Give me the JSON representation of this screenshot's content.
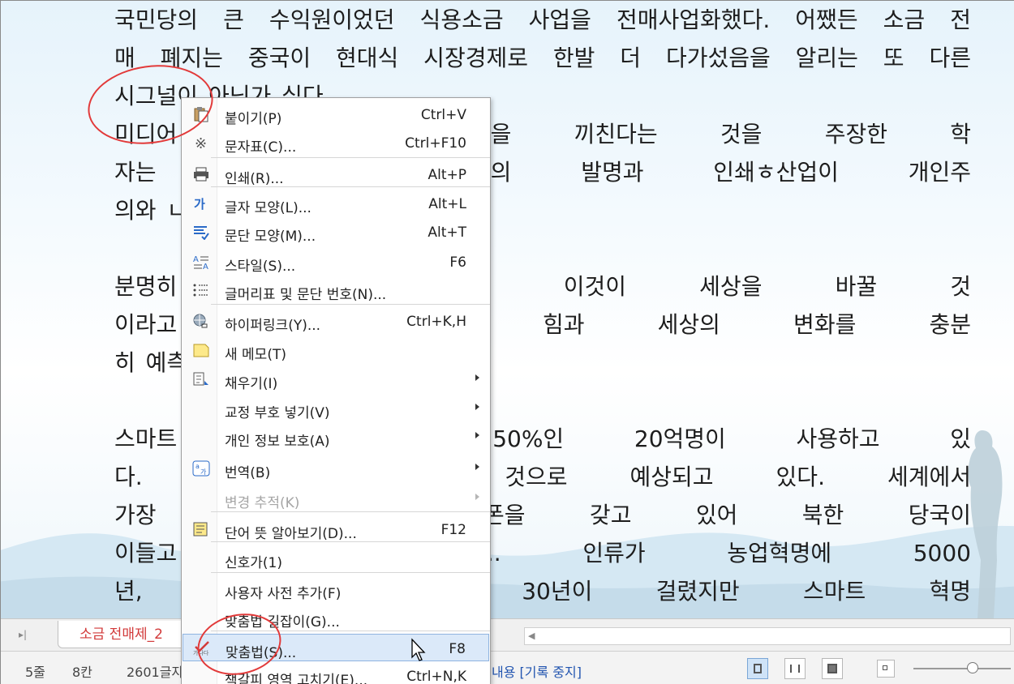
{
  "document": {
    "lines": [
      {
        "text": "국민당의 큰 수익원이었던 식용소금 사업을 전매사업화했다. 어쨌든 소금 전",
        "last": false
      },
      {
        "text": "매 폐지는 중국이 현대식 시장경제로 한발 더 다가섰음을 알리는 또 다른",
        "last": false
      },
      {
        "text": "시그널이 아닌가 싶다.",
        "last": true
      },
      {
        "text": "미디어                        에 엄청난 영향을 끼친다는 것을 주장한 학",
        "last": false
      },
      {
        "text": "자는 미                        기 활자매체의 발명과 인쇄ㅎ산업이 개인주",
        "last": false
      },
      {
        "text": "의와 ㄴ",
        "last": true
      },
      {
        "text": "",
        "last": true
      },
      {
        "text": "분명히                        이폰을 선보이면서 이것이 세상을 바꿀 것",
        "last": false
      },
      {
        "text": "이라고                        인류에게 끼치는 힘과 세상의 변화를 충분",
        "last": false
      },
      {
        "text": "히 예측",
        "last": true
      },
      {
        "text": "",
        "last": true
      },
      {
        "text": "스마트                        세계 성인의 50%인 20억명이 사용하고 있",
        "last": false
      },
      {
        "text": "다. 20                        명을 넘을 것으로 예상되고 있다. 세계에서",
        "last": false
      },
      {
        "text": "가장 ㅍ                        10%가 휴대폰을 갖고 있어 북한 당국이",
        "last": false
      },
      {
        "text": "이들고                        엄청난 혁명이다.. 인류가 농업혁명에 5000",
        "last": false
      },
      {
        "text": "년, 산                        지털 혁명에 30년이 걸렸지만 스마트 혁명",
        "last": false
      }
    ]
  },
  "tabbar": {
    "tab_label": "소금 전매제_2"
  },
  "statusbar": {
    "line": "5줄",
    "col": "8칸",
    "chars": "2601글자",
    "track": "내용 [기록 중지]"
  },
  "menu": {
    "items": [
      {
        "label": "붙이기(P)",
        "shortcut": "Ctrl+V",
        "icon": "paste-icon",
        "submenu": false,
        "disabled": false
      },
      {
        "label": "문자표(C)...",
        "shortcut": "Ctrl+F10",
        "icon": "symbol-icon",
        "submenu": false,
        "disabled": false
      },
      {
        "label": "인쇄(R)...",
        "shortcut": "Alt+P",
        "icon": "print-icon",
        "submenu": false,
        "disabled": false
      },
      {
        "label": "글자 모양(L)...",
        "shortcut": "Alt+L",
        "icon": "char-shape-icon",
        "submenu": false,
        "disabled": false
      },
      {
        "label": "문단 모양(M)...",
        "shortcut": "Alt+T",
        "icon": "paragraph-shape-icon",
        "submenu": false,
        "disabled": false
      },
      {
        "label": "스타일(S)...",
        "shortcut": "F6",
        "icon": "style-icon",
        "submenu": false,
        "disabled": false
      },
      {
        "label": "글머리표 및 문단 번호(N)...",
        "shortcut": "",
        "icon": "bullet-numbering-icon",
        "submenu": false,
        "disabled": false
      },
      {
        "label": "하이퍼링크(Y)...",
        "shortcut": "Ctrl+K,H",
        "icon": "hyperlink-icon",
        "submenu": false,
        "disabled": false
      },
      {
        "label": "새 메모(T)",
        "shortcut": "",
        "icon": "memo-icon",
        "submenu": false,
        "disabled": false
      },
      {
        "label": "채우기(I)",
        "shortcut": "",
        "icon": "fill-icon",
        "submenu": true,
        "disabled": false
      },
      {
        "label": "교정 부호 넣기(V)",
        "shortcut": "",
        "icon": "",
        "submenu": true,
        "disabled": false
      },
      {
        "label": "개인 정보 보호(A)",
        "shortcut": "",
        "icon": "",
        "submenu": true,
        "disabled": false
      },
      {
        "label": "번역(B)",
        "shortcut": "",
        "icon": "translate-icon",
        "submenu": true,
        "disabled": false
      },
      {
        "label": "변경 추적(K)",
        "shortcut": "",
        "icon": "",
        "submenu": true,
        "disabled": true
      },
      {
        "label": "단어 뜻 알아보기(D)...",
        "shortcut": "F12",
        "icon": "dictionary-icon",
        "submenu": false,
        "disabled": false
      },
      {
        "label": "신호가(1)",
        "shortcut": "",
        "icon": "",
        "submenu": false,
        "disabled": false
      },
      {
        "label": "사용자 사전 추가(F)",
        "shortcut": "",
        "icon": "",
        "submenu": false,
        "disabled": false
      },
      {
        "label": "맞춤법 길잡이(G)...",
        "shortcut": "",
        "icon": "",
        "submenu": false,
        "disabled": false
      },
      {
        "label": "맞춤법(S)...",
        "shortcut": "F8",
        "icon": "spellcheck-icon",
        "submenu": false,
        "disabled": false,
        "highlighted": true
      },
      {
        "label": "책갈피 영역 고치기(E)...",
        "shortcut": "Ctrl+N,K",
        "icon": "",
        "submenu": false,
        "disabled": false
      }
    ]
  },
  "colors": {
    "accent": "#2255b0",
    "annotation": "#e23a3a",
    "tab_text": "#d23a3a",
    "highlight": "#dbe9f9"
  }
}
